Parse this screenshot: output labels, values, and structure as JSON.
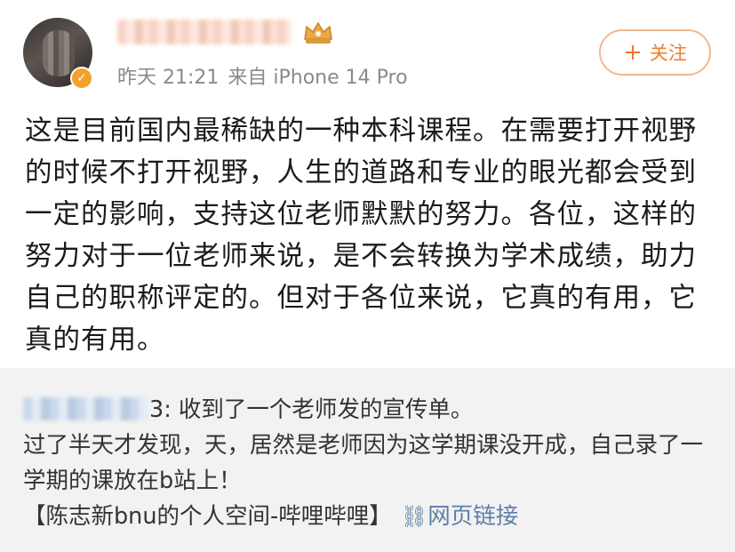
{
  "post": {
    "meta": {
      "time": "昨天 21:21",
      "source": "来自 iPhone 14 Pro"
    },
    "follow_label": "关注",
    "follow_plus": "+",
    "body": "这是目前国内最稀缺的一种本科课程。在需要打开视野的时候不打开视野，人生的道路和专业的眼光都会受到一定的影响，支持这位老师默默的努力。各位，这样的努力对于一位老师来说，是不会转换为学术成绩，助力自己的职称评定的。但对于各位来说，它真的有用，它真的有用。"
  },
  "repost": {
    "mention_suffix": "3:",
    "text_1": " 收到了一个老师发的宣传单。",
    "text_2": "过了半天才发现，天，居然是老师因为这学期课没开成，自己录了一学期的课放在b站上！",
    "bracket_text": "【陈志新bnu的个人空间-哔哩哔哩】",
    "link_label": "网页链接"
  },
  "colors": {
    "accent": "#f07c2d",
    "link": "#5c7fa7",
    "repost_bg": "#f2f2f2"
  },
  "icons": {
    "follow": "plus-icon",
    "link": "link-icon",
    "badge": "crown-icon",
    "verified": "verified-badge-icon"
  }
}
